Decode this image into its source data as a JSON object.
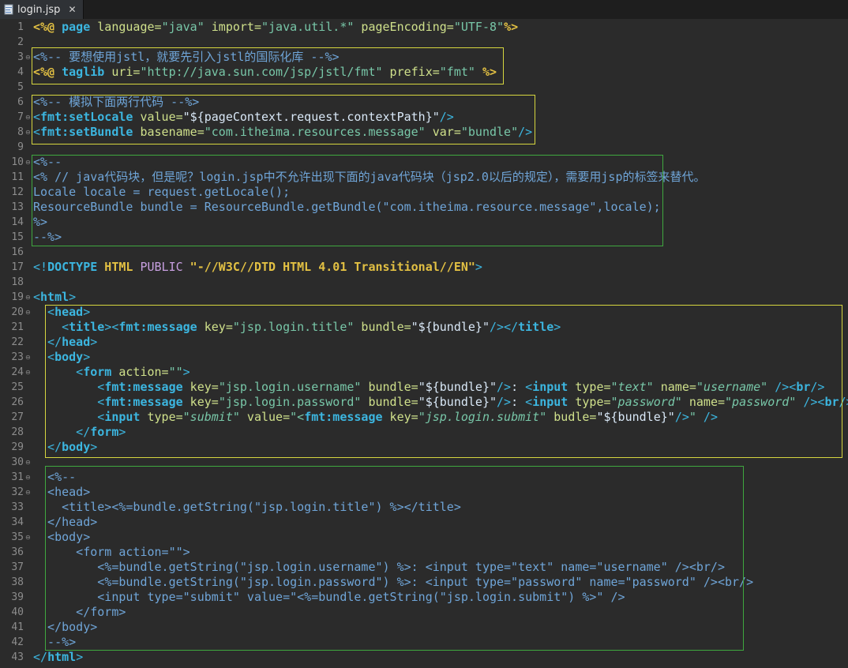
{
  "tab": {
    "title": "login.jsp",
    "close_label": "✕"
  },
  "colors": {
    "background": "#2b2b2b",
    "line_number": "#8c8c8c",
    "directive": "#e2c043",
    "keyword": "#3cb6e0",
    "attr": "#cfe08b",
    "string": "#78c7a8",
    "comment": "#6fa5d8",
    "tag": "#3cb6e0",
    "plain": "#d9e8f7",
    "yellow_box": "#d6d63f",
    "green_box": "#3fa83f"
  },
  "lines": [
    [
      {
        "t": "<%@ ",
        "c": "directive"
      },
      {
        "t": "page",
        "c": "keyword"
      },
      {
        "t": " language=",
        "c": "attr"
      },
      {
        "t": "\"java\"",
        "c": "string"
      },
      {
        "t": " import=",
        "c": "attr"
      },
      {
        "t": "\"java.util.*\"",
        "c": "string"
      },
      {
        "t": " pageEncoding=",
        "c": "attr"
      },
      {
        "t": "\"UTF-8\"",
        "c": "string"
      },
      {
        "t": "%>",
        "c": "directive"
      }
    ],
    [],
    [
      {
        "t": "<%-- 要想使用jstl，就要先引入jstl的国际化库 --%>",
        "c": "comment"
      }
    ],
    [
      {
        "t": "<%@ ",
        "c": "directive"
      },
      {
        "t": "taglib",
        "c": "keyword"
      },
      {
        "t": " uri=",
        "c": "attr"
      },
      {
        "t": "\"http://java.sun.com/jsp/jstl/fmt\"",
        "c": "string"
      },
      {
        "t": " prefix=",
        "c": "attr"
      },
      {
        "t": "\"fmt\"",
        "c": "string"
      },
      {
        "t": " %>",
        "c": "directive"
      }
    ],
    [],
    [
      {
        "t": "<%-- 模拟下面两行代码 --%>",
        "c": "comment"
      }
    ],
    [
      {
        "t": "<",
        "c": "tag"
      },
      {
        "t": "fmt:setLocale",
        "c": "keyword"
      },
      {
        "t": " value=",
        "c": "attr"
      },
      {
        "t": "\"${pageContext.request.contextPath}\"",
        "c": "plain"
      },
      {
        "t": "/>",
        "c": "tag"
      }
    ],
    [
      {
        "t": "<",
        "c": "tag"
      },
      {
        "t": "fmt:setBundle",
        "c": "keyword"
      },
      {
        "t": " basename=",
        "c": "attr"
      },
      {
        "t": "\"com.itheima.resources.message\"",
        "c": "string"
      },
      {
        "t": " var=",
        "c": "attr"
      },
      {
        "t": "\"bundle\"",
        "c": "string"
      },
      {
        "t": "/>",
        "c": "tag"
      }
    ],
    [],
    [
      {
        "t": "<%--",
        "c": "comment"
      }
    ],
    [
      {
        "t": "<% // java代码块，但是呢？login.jsp中不允许出现下面的java代码块（jsp2.0以后的规定），需要用jsp的标签来替代。",
        "c": "comment"
      }
    ],
    [
      {
        "t": "Locale locale = request.getLocale();",
        "c": "comment"
      }
    ],
    [
      {
        "t": "ResourceBundle bundle = ResourceBundle.getBundle(\"com.itheima.resource.message\",locale);",
        "c": "comment"
      }
    ],
    [
      {
        "t": "%>",
        "c": "comment"
      }
    ],
    [
      {
        "t": "--%>",
        "c": "comment"
      }
    ],
    [],
    [
      {
        "t": "<!",
        "c": "tag"
      },
      {
        "t": "DOCTYPE",
        "c": "keyword"
      },
      {
        "t": " HTML",
        "c": "directive"
      },
      {
        "t": " PUBLIC",
        "c": "keyword2"
      },
      {
        "t": " \"-//W3C//DTD HTML 4.01 Transitional//EN\"",
        "c": "directive"
      },
      {
        "t": ">",
        "c": "tag"
      }
    ],
    [],
    [
      {
        "t": "<",
        "c": "tag"
      },
      {
        "t": "html",
        "c": "keyword"
      },
      {
        "t": ">",
        "c": "tag"
      }
    ],
    [
      {
        "t": "  <",
        "c": "tag"
      },
      {
        "t": "head",
        "c": "keyword"
      },
      {
        "t": ">",
        "c": "tag"
      }
    ],
    [
      {
        "t": "    <",
        "c": "tag"
      },
      {
        "t": "title",
        "c": "keyword"
      },
      {
        "t": "><",
        "c": "tag"
      },
      {
        "t": "fmt:message",
        "c": "keyword"
      },
      {
        "t": " key=",
        "c": "attr"
      },
      {
        "t": "\"jsp.login.title\"",
        "c": "string"
      },
      {
        "t": " bundle=",
        "c": "attr"
      },
      {
        "t": "\"${bundle}\"",
        "c": "plain"
      },
      {
        "t": "/></",
        "c": "tag"
      },
      {
        "t": "title",
        "c": "keyword"
      },
      {
        "t": ">",
        "c": "tag"
      }
    ],
    [
      {
        "t": "  </",
        "c": "tag"
      },
      {
        "t": "head",
        "c": "keyword"
      },
      {
        "t": ">",
        "c": "tag"
      }
    ],
    [
      {
        "t": "  <",
        "c": "tag"
      },
      {
        "t": "body",
        "c": "keyword"
      },
      {
        "t": ">",
        "c": "tag"
      }
    ],
    [
      {
        "t": "      <",
        "c": "tag"
      },
      {
        "t": "form",
        "c": "keyword"
      },
      {
        "t": " action=",
        "c": "attr"
      },
      {
        "t": "\"\"",
        "c": "string"
      },
      {
        "t": ">",
        "c": "tag"
      }
    ],
    [
      {
        "t": "         <",
        "c": "tag"
      },
      {
        "t": "fmt:message",
        "c": "keyword"
      },
      {
        "t": " key=",
        "c": "attr"
      },
      {
        "t": "\"jsp.login.username\"",
        "c": "string"
      },
      {
        "t": " bundle=",
        "c": "attr"
      },
      {
        "t": "\"${bundle}\"",
        "c": "plain"
      },
      {
        "t": "/>",
        "c": "tag"
      },
      {
        "t": ":",
        "c": "plain"
      },
      {
        "t": " <",
        "c": "tag"
      },
      {
        "t": "input",
        "c": "keyword"
      },
      {
        "t": " type=",
        "c": "attr"
      },
      {
        "t": "\"text\"",
        "c": "string_it"
      },
      {
        "t": " name=",
        "c": "attr"
      },
      {
        "t": "\"username\"",
        "c": "string_it"
      },
      {
        "t": " /><",
        "c": "tag"
      },
      {
        "t": "br",
        "c": "keyword"
      },
      {
        "t": "/>",
        "c": "tag"
      }
    ],
    [
      {
        "t": "         <",
        "c": "tag"
      },
      {
        "t": "fmt:message",
        "c": "keyword"
      },
      {
        "t": " key=",
        "c": "attr"
      },
      {
        "t": "\"jsp.login.password\"",
        "c": "string"
      },
      {
        "t": " bundle=",
        "c": "attr"
      },
      {
        "t": "\"${bundle}\"",
        "c": "plain"
      },
      {
        "t": "/>",
        "c": "tag"
      },
      {
        "t": ":",
        "c": "plain"
      },
      {
        "t": " <",
        "c": "tag"
      },
      {
        "t": "input",
        "c": "keyword"
      },
      {
        "t": " type=",
        "c": "attr"
      },
      {
        "t": "\"password\"",
        "c": "string_it"
      },
      {
        "t": " name=",
        "c": "attr"
      },
      {
        "t": "\"password\"",
        "c": "string_it"
      },
      {
        "t": " /><",
        "c": "tag"
      },
      {
        "t": "br",
        "c": "keyword"
      },
      {
        "t": "/>",
        "c": "tag"
      }
    ],
    [
      {
        "t": "         <",
        "c": "tag"
      },
      {
        "t": "input",
        "c": "keyword"
      },
      {
        "t": " type=",
        "c": "attr"
      },
      {
        "t": "\"submit\"",
        "c": "string_it"
      },
      {
        "t": " value=",
        "c": "attr"
      },
      {
        "t": "\"<",
        "c": "string"
      },
      {
        "t": "fmt:message",
        "c": "keyword"
      },
      {
        "t": " key=",
        "c": "attr"
      },
      {
        "t": "\"jsp.login.submit\"",
        "c": "string_it"
      },
      {
        "t": " budle=",
        "c": "attr"
      },
      {
        "t": "\"${bundle}\"",
        "c": "plain"
      },
      {
        "t": "/>",
        "c": "tag"
      },
      {
        "t": "\"",
        "c": "string"
      },
      {
        "t": " />",
        "c": "tag"
      }
    ],
    [
      {
        "t": "      </",
        "c": "tag"
      },
      {
        "t": "form",
        "c": "keyword"
      },
      {
        "t": ">",
        "c": "tag"
      }
    ],
    [
      {
        "t": "  </",
        "c": "tag"
      },
      {
        "t": "body",
        "c": "keyword"
      },
      {
        "t": ">",
        "c": "tag"
      }
    ],
    [],
    [
      {
        "t": "  <%--",
        "c": "comment"
      }
    ],
    [
      {
        "t": "  <head>",
        "c": "comment"
      }
    ],
    [
      {
        "t": "    <title><%=bundle.getString(\"jsp.login.title\") %></title>",
        "c": "comment"
      }
    ],
    [
      {
        "t": "  </head>",
        "c": "comment"
      }
    ],
    [
      {
        "t": "  <body>",
        "c": "comment"
      }
    ],
    [
      {
        "t": "      <form action=\"\">",
        "c": "comment"
      }
    ],
    [
      {
        "t": "         <%=bundle.getString(\"jsp.login.username\") %>: <input type=\"text\" name=\"username\" /><br/>",
        "c": "comment"
      }
    ],
    [
      {
        "t": "         <%=bundle.getString(\"jsp.login.password\") %>: <input type=\"password\" name=\"password\" /><br/>",
        "c": "comment"
      }
    ],
    [
      {
        "t": "         <input type=\"submit\" value=\"<%=bundle.getString(\"jsp.login.submit\") %>\" />",
        "c": "comment"
      }
    ],
    [
      {
        "t": "      </form>",
        "c": "comment"
      }
    ],
    [
      {
        "t": "  </body>",
        "c": "comment"
      }
    ],
    [
      {
        "t": "  --%>",
        "c": "comment"
      }
    ],
    [
      {
        "t": "</",
        "c": "tag"
      },
      {
        "t": "html",
        "c": "keyword"
      },
      {
        "t": ">",
        "c": "tag"
      }
    ]
  ],
  "fold_markers": [
    3,
    7,
    8,
    10,
    19,
    20,
    23,
    24,
    30,
    31,
    32,
    35
  ]
}
